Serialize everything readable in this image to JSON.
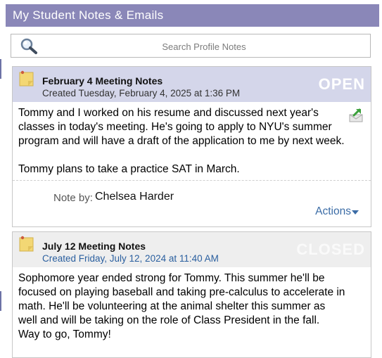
{
  "header": {
    "title": "My Student Notes & Emails"
  },
  "search": {
    "placeholder": "Search Profile Notes",
    "value": ""
  },
  "notes": [
    {
      "title": "February 4 Meeting Notes",
      "created": "Created Tuesday, February 4, 2025 at 1:36 PM",
      "status": "OPEN",
      "body": [
        "Tommy and I worked on his resume and discussed next year's classes in today's meeting. He's going to apply to NYU's summer program and will have a draft of the application to me by next week.",
        "Tommy plans to take a practice SAT in March."
      ],
      "note_by_label": "Note by:",
      "note_by_name": "Chelsea Harder",
      "actions_label": "Actions"
    },
    {
      "title": "July 12 Meeting Notes",
      "created": "Created Friday, July 12, 2024 at 11:40 AM",
      "status": "CLOSED",
      "body": [
        "Sophomore year ended strong for Tommy. This summer he'll be focused on playing baseball and taking pre-calculus to accelerate in math. He'll be volunteering at the animal shelter this summer as well and will be taking on the role of Class President in the fall.",
        "Way to go, Tommy!"
      ]
    }
  ],
  "colors": {
    "header_bg": "#8a87b8",
    "open_head_bg": "#d4d6ea",
    "closed_head_bg": "#eeeeee",
    "link": "#3b6ca6"
  },
  "icons": {
    "search": "search-icon",
    "note": "sticky-note-icon",
    "export": "export-icon",
    "caret": "caret-down-icon"
  }
}
